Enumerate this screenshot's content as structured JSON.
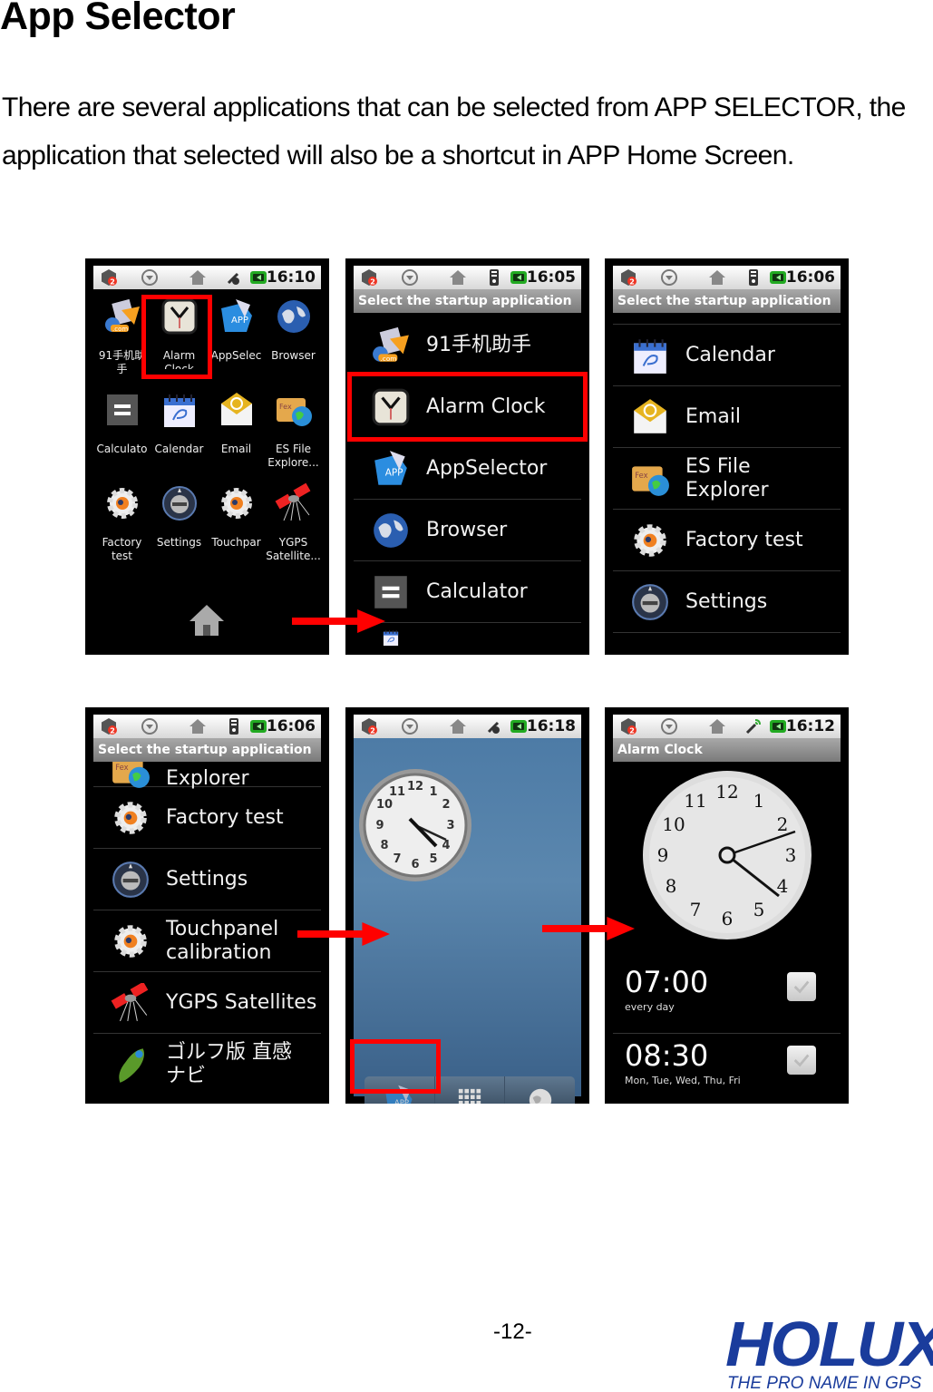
{
  "heading": "App Selector",
  "paragraph": "There are several applications that can be selected from APP SELECTOR, the application that selected will also be a shortcut in APP Home Screen.",
  "status_badge": "2",
  "screens": {
    "s1": {
      "time": "16:10",
      "apps": [
        {
          "label": "91手机助\n手",
          "icon": "91-assistant-icon"
        },
        {
          "label": "Alarm\nClock",
          "icon": "alarm-clock-icon",
          "highlighted": true
        },
        {
          "label": "AppSelec",
          "icon": "app-selector-icon"
        },
        {
          "label": "Browser",
          "icon": "browser-globe-icon"
        },
        {
          "label": "Calculato",
          "icon": "calculator-icon"
        },
        {
          "label": "Calendar",
          "icon": "calendar-icon"
        },
        {
          "label": "Email",
          "icon": "email-icon"
        },
        {
          "label": "ES File\nExplore...",
          "icon": "es-file-explorer-icon"
        },
        {
          "label": "Factory\ntest",
          "icon": "factory-test-gear-icon"
        },
        {
          "label": "Settings",
          "icon": "settings-icon"
        },
        {
          "label": "Touchpar",
          "icon": "touchpanel-gear-icon"
        },
        {
          "label": "YGPS\nSatellite...",
          "icon": "satellite-icon"
        }
      ]
    },
    "s2": {
      "time": "16:05",
      "title": "Select the startup application",
      "items": [
        "91手机助手",
        "Alarm Clock",
        "AppSelector",
        "Browser",
        "Calculator"
      ],
      "highlighted": "Alarm Clock"
    },
    "s3": {
      "time": "16:06",
      "title": "Select the startup application",
      "items": [
        "Calendar",
        "Email",
        "ES File\nExplorer",
        "Factory test",
        "Settings"
      ]
    },
    "s4": {
      "time": "16:06",
      "title": "Select the startup application",
      "items": [
        "Explorer",
        "Factory test",
        "Settings",
        "Touchpanel\ncalibration",
        "YGPS Satellites",
        "ゴルフ版 直感\nナビ"
      ]
    },
    "s5": {
      "time": "16:18",
      "dock": {
        "app_label": "APP"
      },
      "clock_time": "16:18"
    },
    "s6": {
      "time": "16:12",
      "title": "Alarm Clock",
      "alarms": [
        {
          "time": "07:00",
          "days": "every day",
          "enabled": true
        },
        {
          "time": "08:30",
          "days": "Mon, Tue, Wed, Thu, Fri",
          "enabled": true
        }
      ]
    }
  },
  "colors": {
    "highlight_red": "#ff0000",
    "brand_blue": "#1a3c9c"
  },
  "footer": {
    "page_number": "-12-",
    "logo": "HOLUX",
    "tagline": "THE PRO NAME IN GPS"
  }
}
